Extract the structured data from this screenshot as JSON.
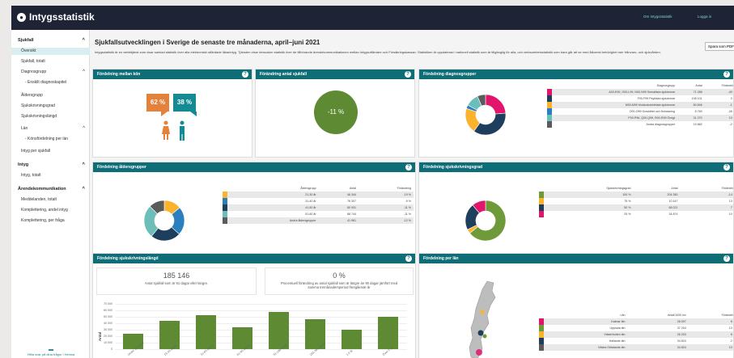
{
  "app": {
    "logo_text": "Intygsstatistik",
    "top_links": [
      "Om Intygsstatistik",
      "Logga in"
    ]
  },
  "sidebar": {
    "sjukfall_header": "Sjukfall",
    "sjukfall_items": [
      "Översikt",
      "Sjukfall, totalt",
      "Diagnosgrupp",
      "- Enskilt diagnoskapitel",
      "Åldersgrupp",
      "Sjukskrivningsgrad",
      "Sjukskrivningslängd",
      "Län",
      "- Könsfördelning per län",
      "Intyg per sjukfall"
    ],
    "intyg_header": "Intyg",
    "intyg_items": [
      "Intyg, totalt"
    ],
    "arende_header": "Ärendekommunikation",
    "arende_items": [
      "Meddelanden, totalt",
      "Komplettering, andel intyg",
      "Komplettering, per fråga"
    ],
    "help_text": "Hitta svar på dina frågor i Hemsa"
  },
  "page": {
    "title": "Sjukfallsutvecklingen i Sverige de senaste tre månaderna, april–juni 2021",
    "intro": "Intygsstatistik är en webbtjänst som visar samlad statistik över alla elektroniskt utfärdade läkarintyg. Tjänsten visar dessutom statistik över de tillhörande ärendekommunikationen mellan Intygsutfärdare och Försäkringskassan. Statistiken är uppdaterad i nationell statistik som är tillgänglig för alla, och verksamhetsstatistik som bara går att se med åtkomst behörighet mer frånvaro- och sjukvården.",
    "save_button": "Spara som PDF"
  },
  "panels": {
    "kon": {
      "title": "Fördelning mellan kön",
      "female_pct": "62 %",
      "male_pct": "38 %",
      "colors": {
        "female": "#e4813a",
        "male": "#138a94"
      }
    },
    "antal": {
      "title": "Förändring antal sjukfall",
      "value": "-11 %",
      "color": "#5d8a32"
    },
    "diagnos": {
      "title": "Fördelning diagnosgrupper",
      "headers": [
        "Diagnosgrupp",
        "Antal",
        "Förändring"
      ],
      "rows": [
        {
          "name": "A00-E90, G00-L99, N00-N99 Somatiska sjukdomar",
          "antal": "71 288",
          "change": "-40 %",
          "color": "#e0156b"
        },
        {
          "name": "F00-F99 Psykiska sjukdomar",
          "antal": "108 101",
          "change": "0 %",
          "color": "#1d3e5c"
        },
        {
          "name": "M00-M99 Muskuloskeletala sjukdomar",
          "antal": "60 846",
          "change": "-1 %",
          "color": "#fbb32e"
        },
        {
          "name": "O00-O99 Graviditet och förlossning",
          "antal": "8 769",
          "change": "-26 %",
          "color": "#2b7fbf"
        },
        {
          "name": "P00-P96, Q00-Q99, R00-R99 Övrigt",
          "antal": "31 270",
          "change": "10 %",
          "color": "#6cbfb8"
        },
        {
          "name": "Andra diagnosgrupper",
          "antal": "19 882",
          "change": "-2 %",
          "color": "#5b5b5b"
        }
      ],
      "pie_values": [
        71288,
        108101,
        60846,
        8769,
        31270,
        19882
      ]
    },
    "alder": {
      "title": "Fördelning åldersgrupper",
      "headers": [
        "Åldersgrupp",
        "Antal",
        "Förändring"
      ],
      "rows": [
        {
          "name": "21-30 år",
          "antal": "46 344",
          "change": "-19 %",
          "color": "#fbb32e"
        },
        {
          "name": "31-40 år",
          "antal": "76 307",
          "change": "-9 %",
          "color": "#2b7fbf"
        },
        {
          "name": "41-50 år",
          "antal": "80 931",
          "change": "-11 %",
          "color": "#1d3e5c"
        },
        {
          "name": "51-60 år",
          "antal": "88 744",
          "change": "-11 %",
          "color": "#6cbfb8"
        },
        {
          "name": "Andra åldersgrupper",
          "antal": "41 961",
          "change": "-12 %",
          "color": "#5b5b5b"
        }
      ],
      "pie_values": [
        46344,
        76307,
        80931,
        88744,
        41961
      ]
    },
    "grad": {
      "title": "Fördelning sjukskrivningsgrad",
      "headers": [
        "Sjukskrivningsgrad",
        "Antal",
        "Förändring"
      ],
      "rows": [
        {
          "name": "100 %",
          "antal": "204 350",
          "change": "-14 %",
          "color": "#6f9a3a"
        },
        {
          "name": "75 %",
          "antal": "10 447",
          "change": "13 %",
          "color": "#fbb32e"
        },
        {
          "name": "50 %",
          "antal": "68 021",
          "change": "7 %",
          "color": "#1d3e5c"
        },
        {
          "name": "25 %",
          "antal": "34 874",
          "change": "10 %",
          "color": "#e0156b"
        }
      ],
      "pie_values": [
        204350,
        10447,
        68021,
        34874
      ]
    },
    "langd": {
      "title": "Fördelning sjukskrivningslängd",
      "stat1_value": "185 146",
      "stat1_text": "Antal sjukfall som är 91 dagar eller längre.",
      "stat2_value": "0 %",
      "stat2_text": "Procentuell förändring av antal sjukfall som är längre än 90 dagar jämfört med samma tremånadersperiod föregående år",
      "ylabel": "Antal",
      "bar_color": "#5d8a32"
    },
    "lan": {
      "title": "Fördelning per län",
      "headers": [
        "Län",
        "Antal/1000 inv",
        "Förändring"
      ],
      "rows": [
        {
          "name": "Kalmar län",
          "antal": "28 007",
          "change": "6 %",
          "color": "#e0156b"
        },
        {
          "name": "Uppsala län",
          "antal": "37 204",
          "change": "13 %",
          "color": "#6f9a3a"
        },
        {
          "name": "Västerbotten län",
          "antal": "26 203",
          "change": "6 %",
          "color": "#fbb32e"
        },
        {
          "name": "Hallands län",
          "antal": "34 824",
          "change": "2 %",
          "color": "#1d3e5c"
        },
        {
          "name": "Västra Götalands län",
          "antal": "34 824",
          "change": "10 %",
          "color": "#5b5b5b"
        }
      ]
    }
  },
  "chart_data": {
    "type": "bar",
    "title": "Fördelning sjukskrivningslängd",
    "ylabel": "Antal",
    "ylim": [
      0,
      70000
    ],
    "yticks": [
      "70 000",
      "60 000",
      "50 000",
      "40 000",
      "30 000",
      "20 000",
      "10 000",
      "0"
    ],
    "categories": [
      "Under 15 dagar",
      "15-30 dagar",
      "31-60 dagar",
      "61-90 dagar",
      "91-180 dagar",
      "181-365 dagar",
      "1-2 år",
      "Över 2 år"
    ],
    "values": [
      24000,
      44000,
      53000,
      34000,
      58000,
      46000,
      30000,
      50000
    ]
  }
}
